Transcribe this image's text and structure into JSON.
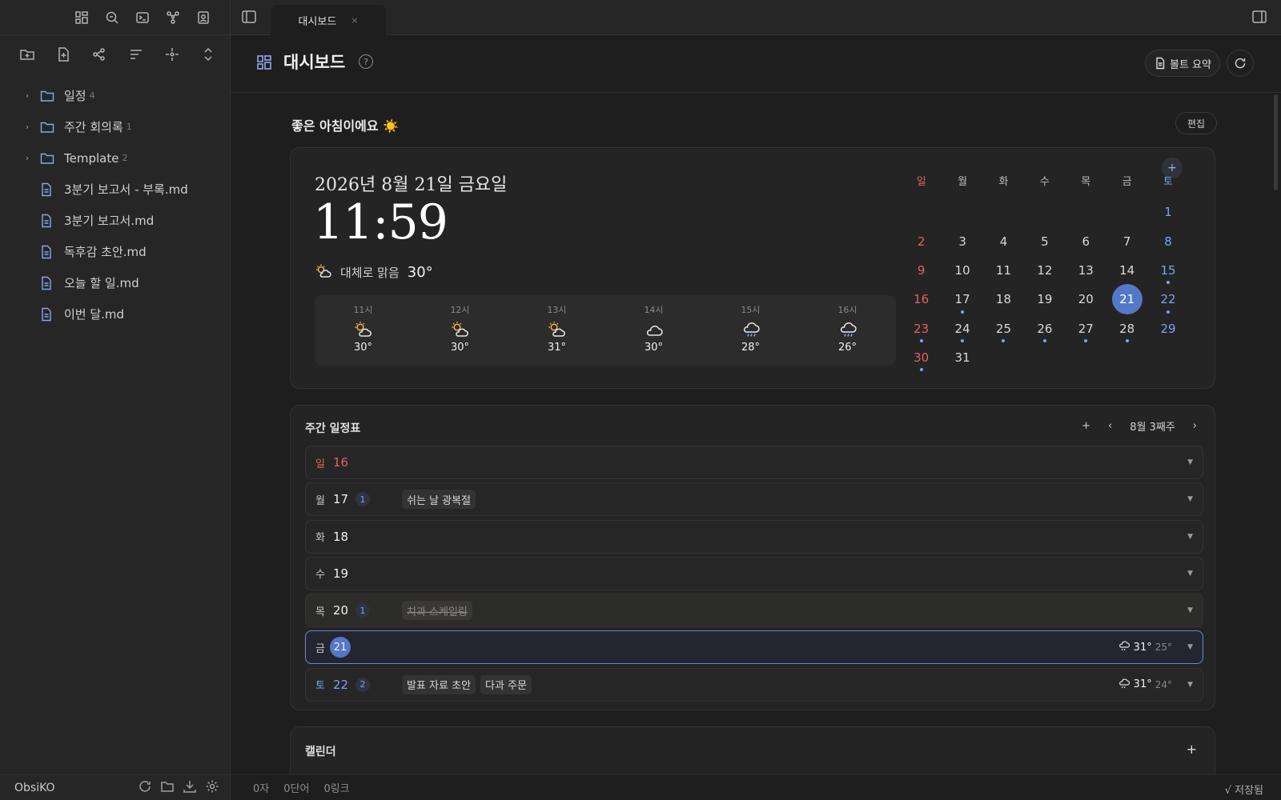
{
  "sidebar": {
    "vault_name": "ObsiKO",
    "tree": [
      {
        "type": "folder",
        "name": "일정",
        "count": "4"
      },
      {
        "type": "folder",
        "name": "주간 회의록",
        "count": "1"
      },
      {
        "type": "folder",
        "name": "Template",
        "count": "2"
      },
      {
        "type": "file",
        "name": "3분기 보고서 - 부록.md"
      },
      {
        "type": "file",
        "name": "3분기 보고서.md"
      },
      {
        "type": "file",
        "name": "독후감 초안.md"
      },
      {
        "type": "file",
        "name": "오늘 할 일.md"
      },
      {
        "type": "file",
        "name": "이번 달.md"
      }
    ]
  },
  "tab": {
    "label": "대시보드",
    "close": "×"
  },
  "header": {
    "title": "대시보드",
    "help": "?",
    "summary_label": "볼트 요약"
  },
  "greeting": "좋은 아침이에요 ☀️",
  "edit_label": "편집",
  "hero": {
    "date": "2026년 8월 21일 금요일",
    "time": "11:59",
    "condition": "대체로 맑음",
    "temp": "30°",
    "hourly": [
      {
        "label": "11시",
        "icon": "sun-cloud-icon",
        "temp": "30°"
      },
      {
        "label": "12시",
        "icon": "sun-cloud-icon",
        "temp": "30°"
      },
      {
        "label": "13시",
        "icon": "sun-cloud-icon",
        "temp": "31°"
      },
      {
        "label": "14시",
        "icon": "cloud-icon",
        "temp": "30°"
      },
      {
        "label": "15시",
        "icon": "rain-icon",
        "temp": "28°"
      },
      {
        "label": "16시",
        "icon": "rain-icon",
        "temp": "26°"
      }
    ]
  },
  "mini_calendar": {
    "add": "+",
    "weekdays": [
      "일",
      "월",
      "화",
      "수",
      "목",
      "금",
      "토"
    ],
    "leading_blanks": 6,
    "days": [
      "1",
      "2",
      "3",
      "4",
      "5",
      "6",
      "7",
      "8",
      "9",
      "10",
      "11",
      "12",
      "13",
      "14",
      "15",
      "16",
      "17",
      "18",
      "19",
      "20",
      "21",
      "22",
      "23",
      "24",
      "25",
      "26",
      "27",
      "28",
      "29",
      "30",
      "31"
    ],
    "dot_days": [
      "15",
      "17",
      "22",
      "23",
      "24",
      "25",
      "26",
      "27",
      "28",
      "30"
    ],
    "today": "21"
  },
  "weekly": {
    "title": "주간 일정표",
    "add": "+",
    "prev": "‹",
    "next": "›",
    "range": "8월 3째주",
    "rows": [
      {
        "day": "일",
        "num": "16",
        "badge": "",
        "events": [],
        "hi": "",
        "lo": "",
        "kind": "sun"
      },
      {
        "day": "월",
        "num": "17",
        "badge": "1",
        "events": [
          {
            "text": "쉬는 날 광복절",
            "done": false
          }
        ],
        "hi": "",
        "lo": "",
        "kind": ""
      },
      {
        "day": "화",
        "num": "18",
        "badge": "",
        "events": [],
        "hi": "",
        "lo": "",
        "kind": ""
      },
      {
        "day": "수",
        "num": "19",
        "badge": "",
        "events": [],
        "hi": "",
        "lo": "",
        "kind": ""
      },
      {
        "day": "목",
        "num": "20",
        "badge": "1",
        "events": [
          {
            "text": "치과 스케일링",
            "done": true
          }
        ],
        "hi": "",
        "lo": "",
        "kind": "dim"
      },
      {
        "day": "금",
        "num": "21",
        "badge": "",
        "events": [],
        "hi": "31°",
        "lo": "25°",
        "kind": "today"
      },
      {
        "day": "토",
        "num": "22",
        "badge": "2",
        "events": [
          {
            "text": "발표 자료 초안",
            "done": false
          },
          {
            "text": "다과 주문",
            "done": false
          }
        ],
        "hi": "31°",
        "lo": "24°",
        "kind": "sat"
      }
    ]
  },
  "calendar_card": {
    "title": "캘린더",
    "add": "+"
  },
  "status": {
    "chars": "0자",
    "words": "0단어",
    "links": "0링크",
    "saved": "√ 저장됨"
  },
  "colors": {
    "accent": "#5577c8",
    "sunday": "#e06060",
    "saturday": "#7aa2f7",
    "background": "#1e1e1e"
  }
}
